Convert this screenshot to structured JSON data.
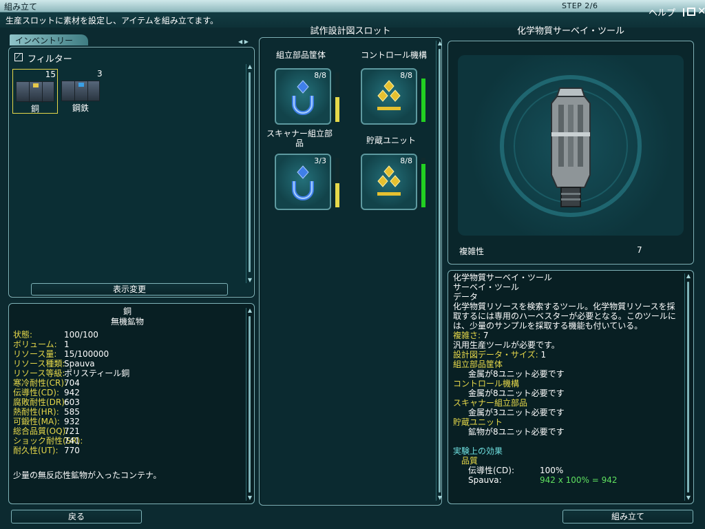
{
  "window": {
    "title": "組み立て",
    "step": "STEP 2/6",
    "help": "ヘルプ",
    "subtitle": "生産スロットに素材を設定し、アイテムを組み立てます。"
  },
  "inventory": {
    "tab_label": "インベントリー",
    "filter_label": "フィルター",
    "items": [
      {
        "name": "銅",
        "count": "15",
        "color": "#3a4b58",
        "selected": true
      },
      {
        "name": "鋼鉄",
        "count": "3",
        "color": "#39485a",
        "selected": false
      }
    ],
    "view_change": "表示変更"
  },
  "resource": {
    "name": "銅",
    "category": "無機鉱物",
    "stats": [
      {
        "label": "状態:",
        "value": "100/100"
      },
      {
        "label": "ボリューム:",
        "value": "1"
      },
      {
        "label": "リソース量:",
        "value": "15/100000"
      },
      {
        "label": "リソース種類:",
        "value": "Spauva"
      },
      {
        "label": "リソース等級:",
        "value": "ポリスティール銅"
      },
      {
        "label": "寒冷耐性(CR):",
        "value": "704"
      },
      {
        "label": "伝導性(CD):",
        "value": "942"
      },
      {
        "label": "腐敗耐性(DR):",
        "value": "603"
      },
      {
        "label": "熱耐性(HR):",
        "value": "585"
      },
      {
        "label": "可鍛性(MA):",
        "value": "932"
      },
      {
        "label": "総合品質(OQ):",
        "value": "721"
      },
      {
        "label": "ショック耐性(SR):",
        "value": "741"
      },
      {
        "label": "耐久性(UT):",
        "value": "770"
      }
    ],
    "description": "少量の無反応性鉱物が入ったコンテナ。"
  },
  "schematic": {
    "title": "試作設計図スロット",
    "slots": [
      {
        "label": "組立部品筐体",
        "count": "8/8",
        "meter_color": "#e6d84a",
        "meter_level": 0.5
      },
      {
        "label": "コントロール機構",
        "count": "8/8",
        "meter_color": "#22d022",
        "meter_level": 0.88
      },
      {
        "label": "スキャナー組立部品",
        "count": "3/3",
        "meter_color": "#e6d84a",
        "meter_level": 0.48
      },
      {
        "label": "貯蔵ユニット",
        "count": "8/8",
        "meter_color": "#22d022",
        "meter_level": 0.88
      }
    ]
  },
  "preview": {
    "title": "化学物質サーベイ・ツール",
    "complexity_label": "複雑性",
    "complexity_value": "7"
  },
  "details": {
    "line1": "化学物質サーベイ・ツール",
    "line2": "サーベイ・ツール",
    "line3": "データ",
    "desc": "化学物質リソースを検索するツール。化学物質リソースを採取するには専用のハーベスターが必要となる。このツールには、少量のサンプルを採取する機能も付いている。",
    "complexity_label": "複雑さ:",
    "complexity_value": "7",
    "tool_req": "汎用生産ツールが必要です。",
    "data_size_label": "設計図データ・サイズ:",
    "data_size_value": "1",
    "requirements": [
      {
        "slot": "組立部品筐体",
        "need": "金属が8ユニット必要です"
      },
      {
        "slot": "コントロール機構",
        "need": "金属が8ユニット必要です"
      },
      {
        "slot": "スキャナー組立部品",
        "need": "金属が3ユニット必要です"
      },
      {
        "slot": "貯蔵ユニット",
        "need": "鉱物が8ユニット必要です"
      }
    ],
    "experiment_title": "実験上の効果",
    "quality_label": "品質",
    "effect_name": "伝導性(CD):",
    "effect_value": "100%",
    "resource_name": "Spauva:",
    "formula": "942 x 100% =  942"
  },
  "footer": {
    "back": "戻る",
    "assemble": "組み立て"
  },
  "colors": {
    "label_yellow": "#e6d84a",
    "value_green": "#5fe05f",
    "accent_cyan": "#6fe0e0",
    "frame": "#7fb4b9"
  }
}
